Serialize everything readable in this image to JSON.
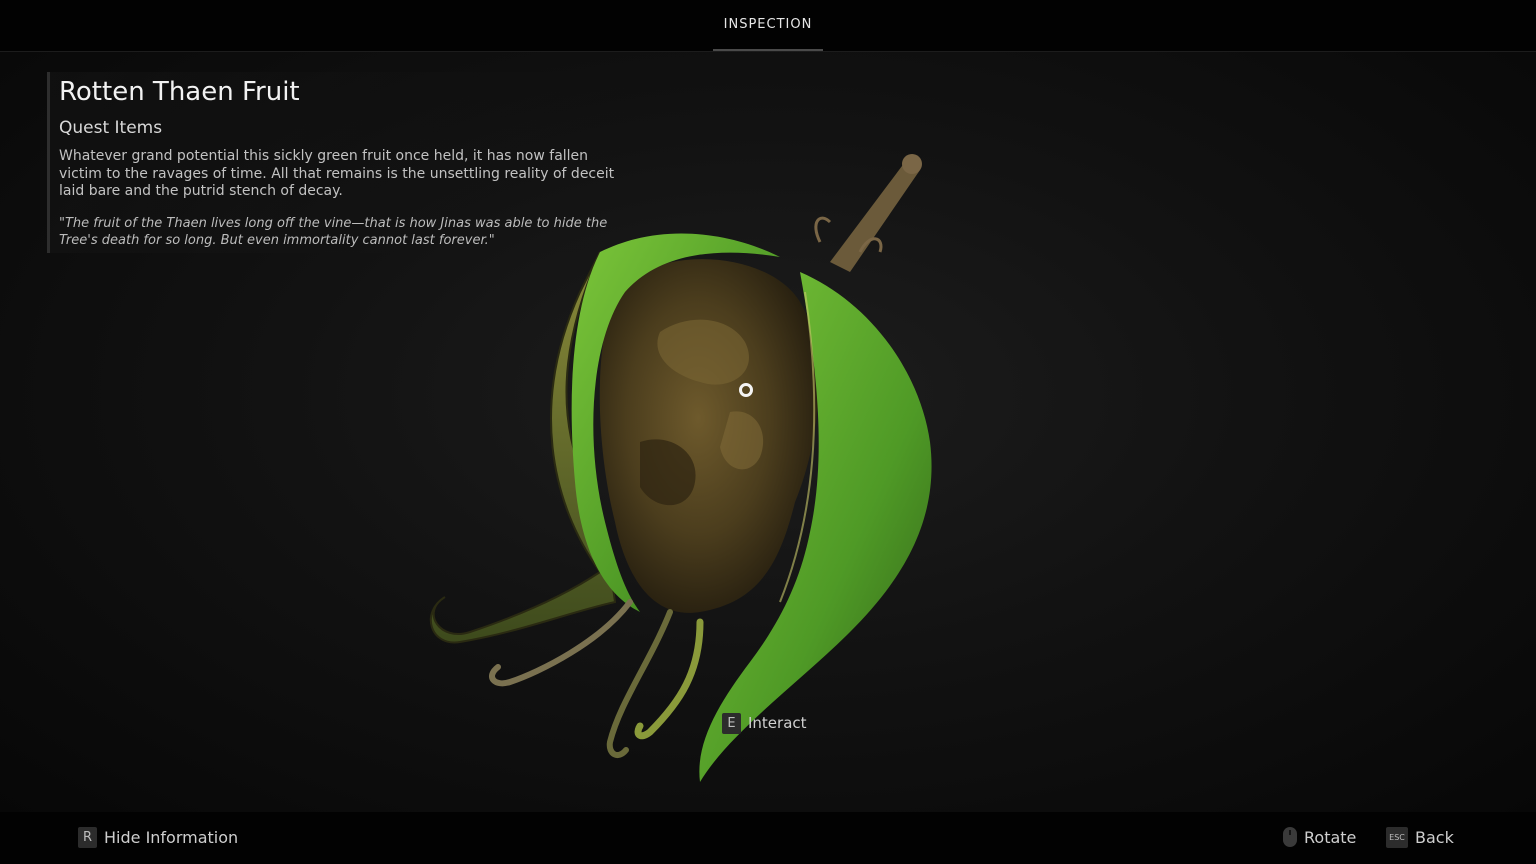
{
  "header": {
    "tab_label": "INSPECTION"
  },
  "item": {
    "name": "Rotten Thaen Fruit",
    "category": "Quest Items",
    "description": "Whatever grand potential this sickly green fruit once held, it has now fallen victim to the ravages of time. All that remains is the unsettling reality of deceit laid bare and the putrid stench of decay.",
    "quote": "\"The fruit of the Thaen lives long off the vine—that is how Jinas was able to hide the Tree's death for so long. But even immortality cannot last forever.\""
  },
  "prompts": {
    "interact": {
      "key": "E",
      "label": "Interact"
    },
    "hide_info": {
      "key": "R",
      "label": "Hide Information"
    },
    "rotate": {
      "icon": "mouse-icon",
      "label": "Rotate"
    },
    "back": {
      "key": "ESC",
      "label": "Back"
    }
  },
  "colors": {
    "leaf_green": "#5fae2e",
    "fruit_brown": "#5a4a26",
    "background": "#0a0a0a"
  }
}
